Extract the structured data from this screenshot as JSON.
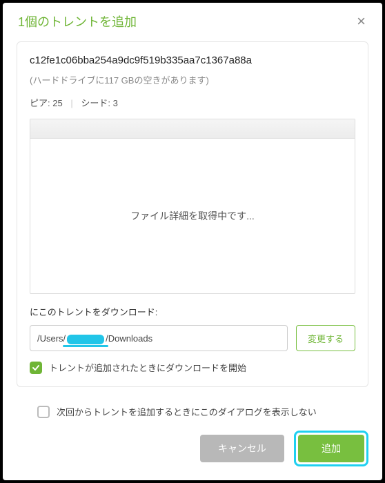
{
  "dialog": {
    "title": "1個のトレントを追加",
    "close_icon": "×"
  },
  "torrent": {
    "hash": "c12fe1c06bba254a9dc9f519b335aa7c1367a88a",
    "disk_space": "(ハードドライブに117 GBの空きがあります)",
    "peers_label": "ピア:",
    "peers_value": "25",
    "seeds_label": "シード:",
    "seeds_value": "3"
  },
  "files": {
    "loading": "ファイル詳細を取得中です..."
  },
  "download": {
    "label": "にこのトレントをダウンロード:",
    "path_prefix": "/Users/",
    "path_suffix": "/Downloads",
    "change_btn": "変更する",
    "start_on_add": "トレントが追加されたときにダウンロードを開始"
  },
  "footer": {
    "dont_show": "次回からトレントを追加するときにこのダイアログを表示しない",
    "cancel": "キャンセル",
    "add": "追加"
  }
}
